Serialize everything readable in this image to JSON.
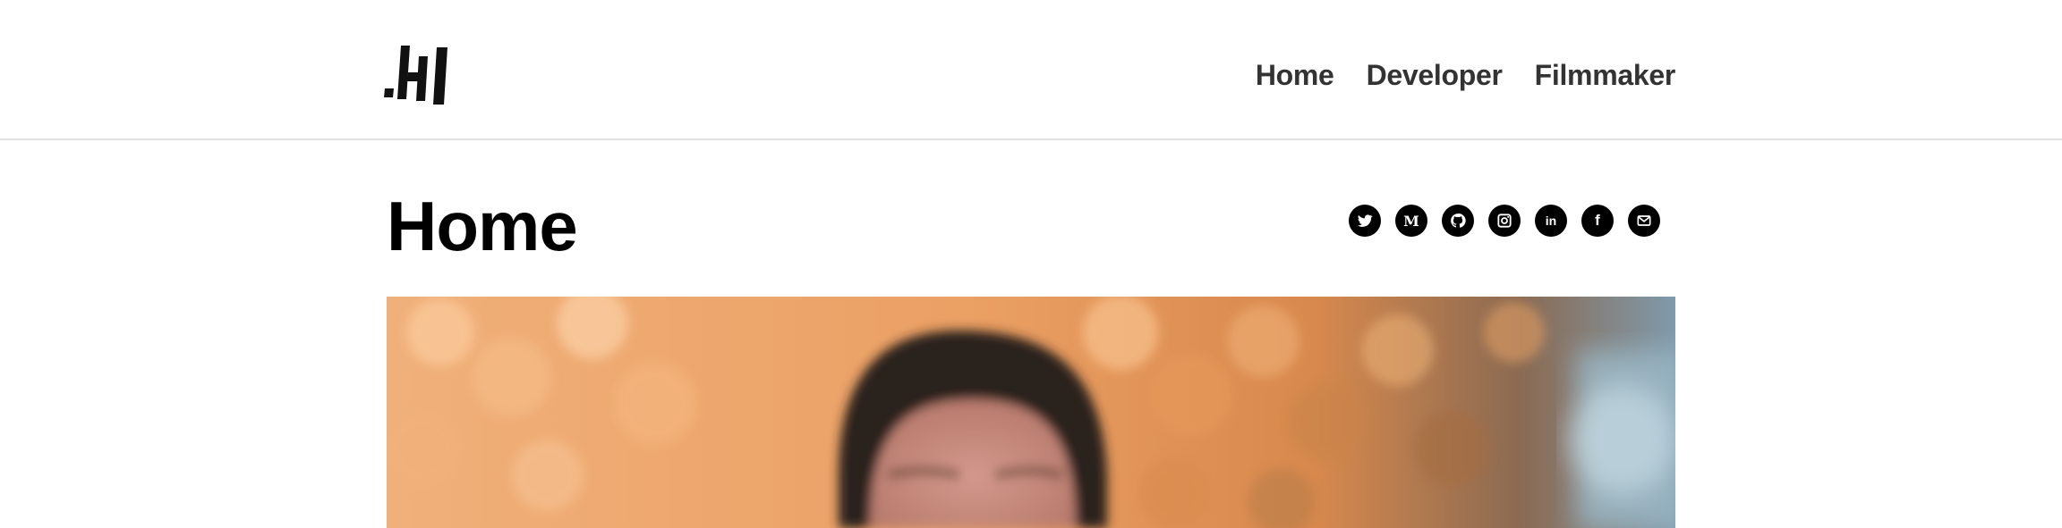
{
  "header": {
    "logo_icon": "jh-logo-icon",
    "nav": [
      {
        "label": "Home"
      },
      {
        "label": "Developer"
      },
      {
        "label": "Filmmaker"
      }
    ]
  },
  "main": {
    "title": "Home",
    "social_icons": [
      {
        "name": "twitter-icon"
      },
      {
        "name": "medium-icon",
        "glyph": "M"
      },
      {
        "name": "github-icon"
      },
      {
        "name": "instagram-icon"
      },
      {
        "name": "linkedin-icon",
        "glyph": "in"
      },
      {
        "name": "facebook-icon",
        "glyph": "f"
      },
      {
        "name": "email-icon"
      }
    ],
    "hero_image": {
      "subject": "hero-portrait-image",
      "colors": {
        "bokeh": "#e9a467",
        "hair": "#2b211c",
        "skin": "#c98d80",
        "right_bg": "#7f9aab"
      }
    }
  }
}
